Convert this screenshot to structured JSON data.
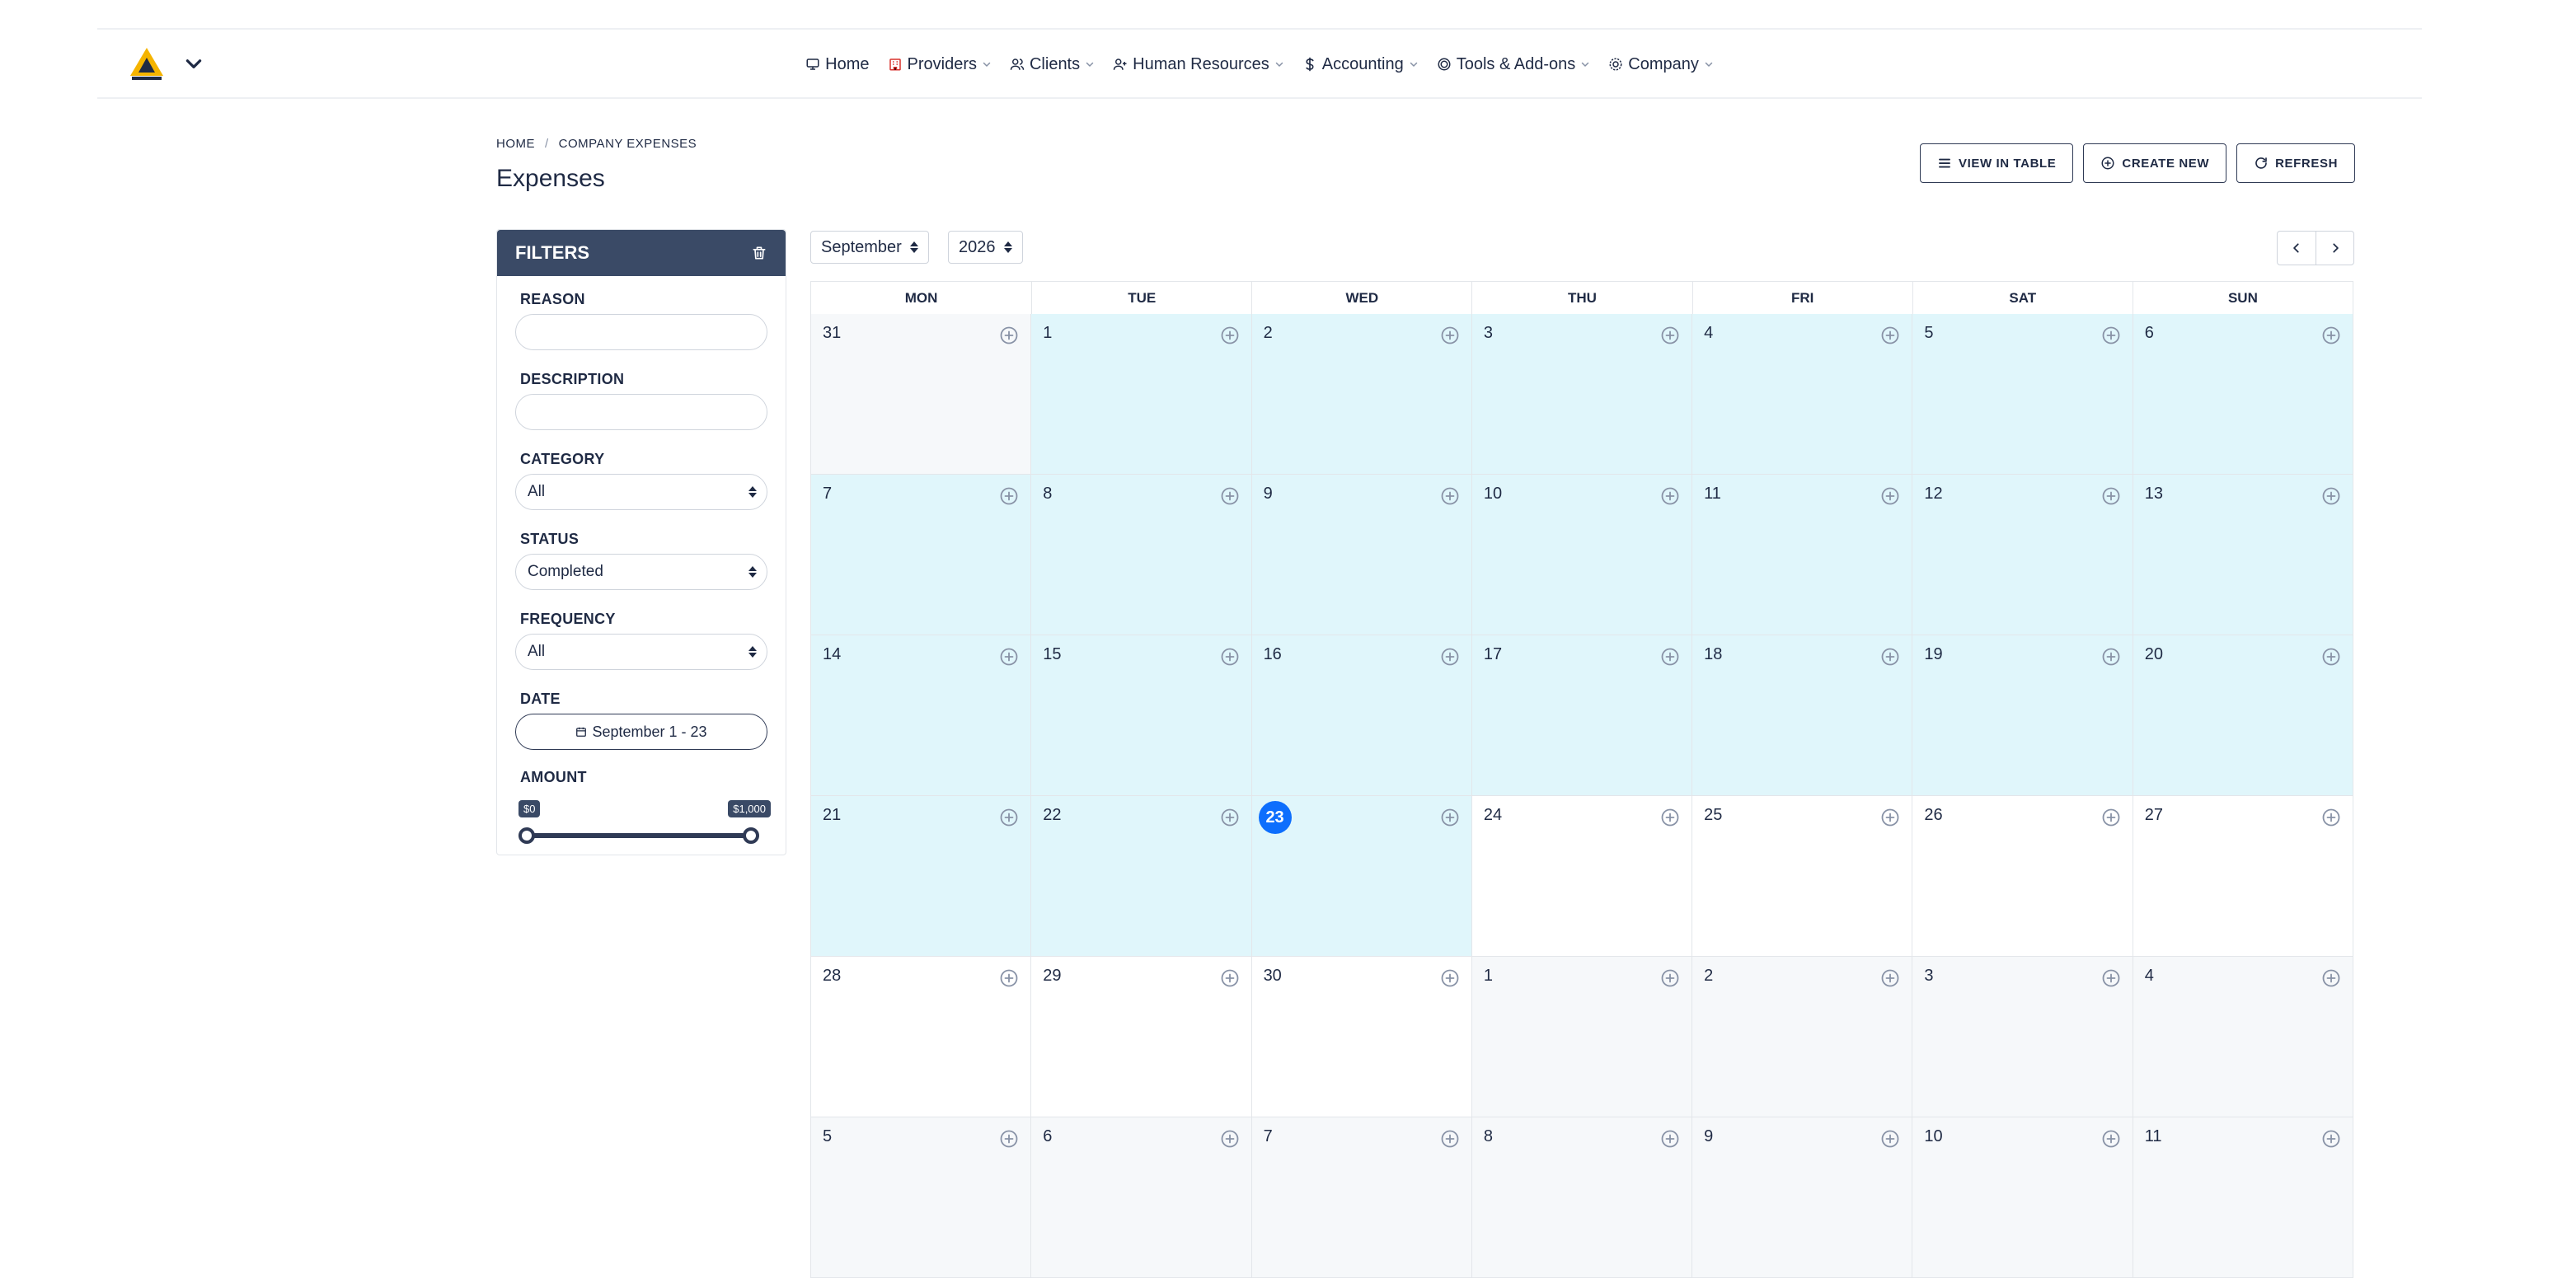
{
  "nav": {
    "items": [
      {
        "label": "Home",
        "icon": "monitor-icon",
        "dropdown": false
      },
      {
        "label": "Providers",
        "icon": "building-icon",
        "dropdown": true
      },
      {
        "label": "Clients",
        "icon": "users-icon",
        "dropdown": true
      },
      {
        "label": "Human Resources",
        "icon": "user-plus-icon",
        "dropdown": true
      },
      {
        "label": "Accounting",
        "icon": "dollar-icon",
        "dropdown": true
      },
      {
        "label": "Tools & Add-ons",
        "icon": "target-icon",
        "dropdown": true
      },
      {
        "label": "Company",
        "icon": "gear-icon",
        "dropdown": true
      }
    ]
  },
  "breadcrumb": {
    "home": "HOME",
    "separator": "/",
    "current": "COMPANY EXPENSES"
  },
  "page": {
    "title": "Expenses"
  },
  "actions": {
    "view_table": "VIEW IN TABLE",
    "create_new": "CREATE NEW",
    "refresh": "REFRESH"
  },
  "filters": {
    "title": "FILTERS",
    "reason_label": "REASON",
    "reason_value": "",
    "description_label": "DESCRIPTION",
    "description_value": "",
    "category_label": "CATEGORY",
    "category_value": "All",
    "status_label": "STATUS",
    "status_value": "Completed",
    "frequency_label": "FREQUENCY",
    "frequency_value": "All",
    "date_label": "DATE",
    "date_value": "September 1 - 23",
    "amount_label": "AMOUNT",
    "amount_min": "$0",
    "amount_max": "$1,000"
  },
  "calendar": {
    "month": "September",
    "year": "2026",
    "weekdays": [
      "MON",
      "TUE",
      "WED",
      "THU",
      "FRI",
      "SAT",
      "SUN"
    ],
    "today": 23,
    "days": [
      {
        "d": "31",
        "s": "out"
      },
      {
        "d": "1",
        "s": "in"
      },
      {
        "d": "2",
        "s": "in"
      },
      {
        "d": "3",
        "s": "in"
      },
      {
        "d": "4",
        "s": "in"
      },
      {
        "d": "5",
        "s": "in"
      },
      {
        "d": "6",
        "s": "in"
      },
      {
        "d": "7",
        "s": "in"
      },
      {
        "d": "8",
        "s": "in"
      },
      {
        "d": "9",
        "s": "in"
      },
      {
        "d": "10",
        "s": "in"
      },
      {
        "d": "11",
        "s": "in"
      },
      {
        "d": "12",
        "s": "in"
      },
      {
        "d": "13",
        "s": "in"
      },
      {
        "d": "14",
        "s": "in"
      },
      {
        "d": "15",
        "s": "in"
      },
      {
        "d": "16",
        "s": "in"
      },
      {
        "d": "17",
        "s": "in"
      },
      {
        "d": "18",
        "s": "in"
      },
      {
        "d": "19",
        "s": "in"
      },
      {
        "d": "20",
        "s": "in"
      },
      {
        "d": "21",
        "s": "in"
      },
      {
        "d": "22",
        "s": "in"
      },
      {
        "d": "23",
        "s": "in",
        "today": true
      },
      {
        "d": "24",
        "s": "plain"
      },
      {
        "d": "25",
        "s": "plain"
      },
      {
        "d": "26",
        "s": "plain"
      },
      {
        "d": "27",
        "s": "plain"
      },
      {
        "d": "28",
        "s": "plain"
      },
      {
        "d": "29",
        "s": "plain"
      },
      {
        "d": "30",
        "s": "plain"
      },
      {
        "d": "1",
        "s": "out"
      },
      {
        "d": "2",
        "s": "out"
      },
      {
        "d": "3",
        "s": "out"
      },
      {
        "d": "4",
        "s": "out"
      },
      {
        "d": "5",
        "s": "out"
      },
      {
        "d": "6",
        "s": "out"
      },
      {
        "d": "7",
        "s": "out"
      },
      {
        "d": "8",
        "s": "out"
      },
      {
        "d": "9",
        "s": "out"
      },
      {
        "d": "10",
        "s": "out"
      },
      {
        "d": "11",
        "s": "out"
      }
    ]
  },
  "colors": {
    "primary": "#3a4a66",
    "today": "#0d6efd",
    "selected_range": "#e0f6fb",
    "other_month": "#f6f8fa",
    "border": "#e3e6ea"
  }
}
